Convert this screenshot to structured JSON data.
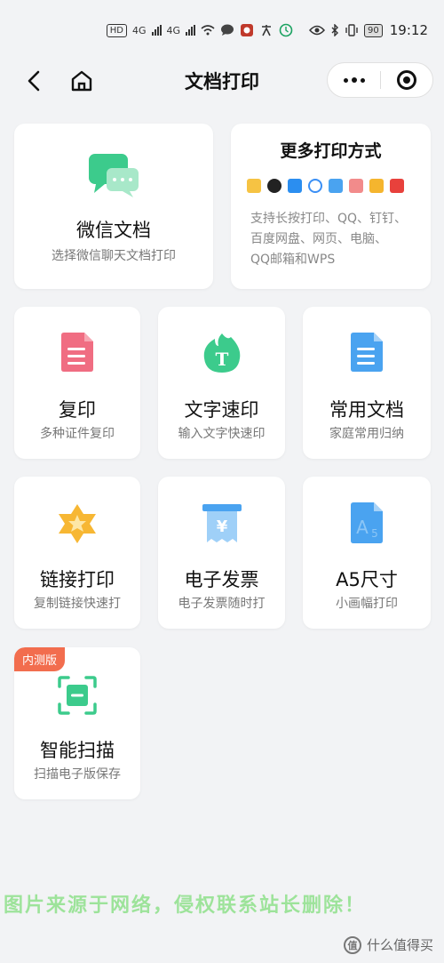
{
  "status_bar": {
    "hd_label": "HD",
    "net1": "4G",
    "net2": "4G",
    "battery": "90",
    "time": "19:12"
  },
  "navbar": {
    "title": "文档打印"
  },
  "cards": {
    "wechat_doc": {
      "title": "微信文档",
      "subtitle": "选择微信聊天文档打印"
    },
    "more_methods": {
      "title": "更多打印方式",
      "description_lines": [
        "支持长按打印、QQ、钉钉、",
        "百度网盘、网页、电脑、",
        "QQ邮箱和WPS"
      ],
      "apps": [
        "folder-icon",
        "qq-icon",
        "dingtalk-icon",
        "baidu-netdisk-icon",
        "webpage-icon",
        "computer-icon",
        "qq-mail-icon",
        "wps-icon"
      ]
    },
    "copy": {
      "title": "复印",
      "subtitle": "多种证件复印"
    },
    "text_print": {
      "title": "文字速印",
      "subtitle": "输入文字快速印"
    },
    "common_docs": {
      "title": "常用文档",
      "subtitle": "家庭常用归纳"
    },
    "link_print": {
      "title": "链接打印",
      "subtitle": "复制链接快速打"
    },
    "e_invoice": {
      "title": "电子发票",
      "subtitle": "电子发票随时打"
    },
    "a5_size": {
      "title": "A5尺寸",
      "subtitle": "小画幅打印"
    },
    "smart_scan": {
      "title": "智能扫描",
      "subtitle": "扫描电子版保存",
      "badge": "内测版"
    }
  },
  "icon_glyphs": {
    "text_print_letter": "T",
    "invoice_symbol": "¥",
    "a5_letter": "A",
    "a5_digit": "5",
    "zdm_logo": "值"
  },
  "watermark": "图片来源于网络，侵权联系站长删除！",
  "footer_brand": "什么值得买",
  "colors": {
    "green": "#3ccb8c",
    "pink": "#f06d82",
    "blue": "#4aa3f0",
    "gold": "#f7b733",
    "badge": "#f26d4e"
  }
}
